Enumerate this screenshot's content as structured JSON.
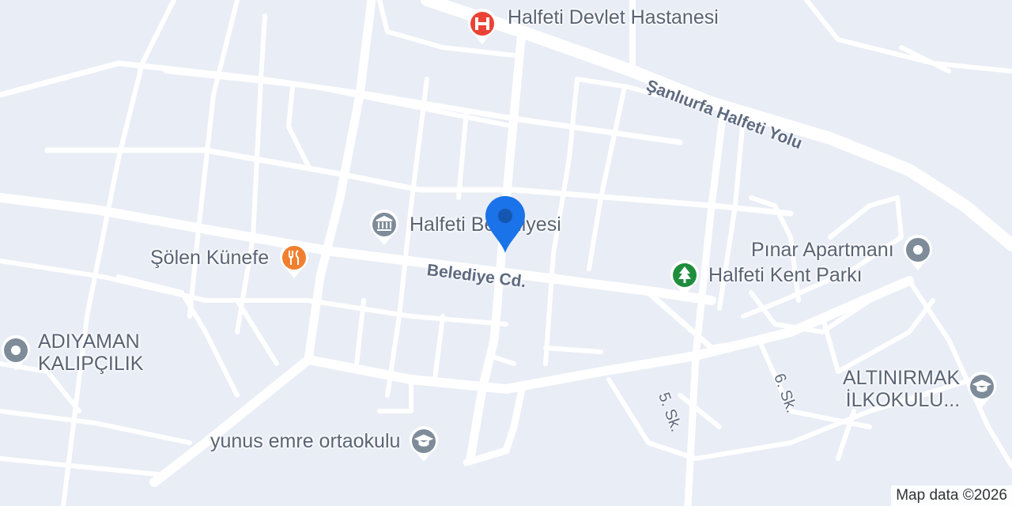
{
  "colors": {
    "background": "#e9edf6",
    "road": "#ffffff",
    "poi_gray": "#7e8b99",
    "poi_red": "#ea4335",
    "poi_orange": "#f08030",
    "poi_green": "#1e8e3e",
    "marker_blue": "#1a73e8"
  },
  "pois": {
    "hospital": {
      "label": "Halfeti Devlet Hastanesi",
      "icon": "hospital-icon"
    },
    "municipality": {
      "label": "Halfeti Belediyesi",
      "icon": "government-building-icon"
    },
    "restaurant": {
      "label": "Şölen Künefe",
      "icon": "restaurant-icon"
    },
    "park": {
      "label": "Halfeti Kent Parkı",
      "icon": "tree-icon"
    },
    "apartment": {
      "label": "Pınar Apartmanı",
      "icon": "place-icon"
    },
    "business": {
      "line1": "ADIYAMAN",
      "line2": "KALIPÇILIK",
      "icon": "place-icon"
    },
    "primary_school": {
      "line1": "ALTINIRMAK",
      "line2": "İLKOKULU...",
      "icon": "school-icon"
    },
    "middle_school": {
      "label": "yunus emre ortaokulu",
      "icon": "school-icon"
    }
  },
  "streets": {
    "highway": "Şanlıurfa Halfeti Yolu",
    "main": "Belediye Cd.",
    "fifth": "5. Sk.",
    "sixth": "6. Sk."
  },
  "attribution": "Map data ©2026"
}
